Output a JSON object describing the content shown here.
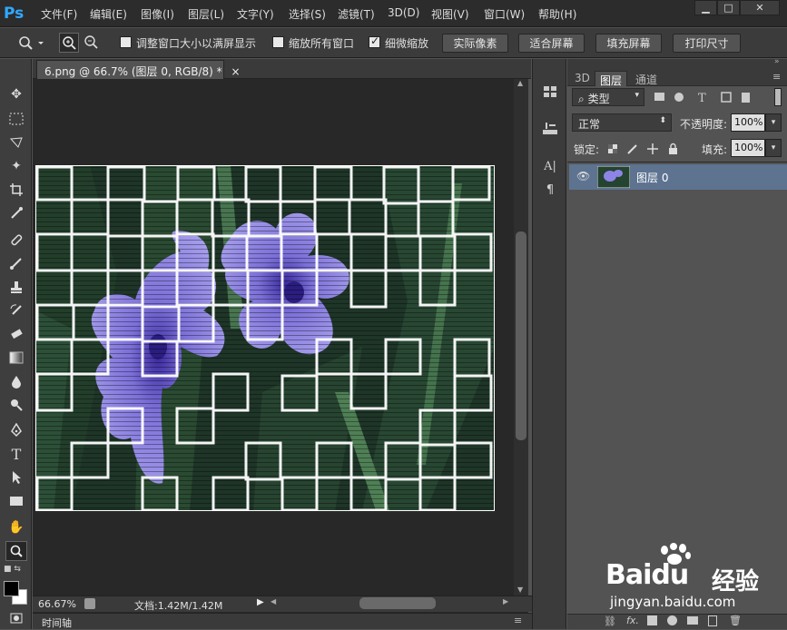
{
  "app": {
    "logo": "Ps",
    "brand_color": "#31a8ff"
  },
  "menu": [
    "文件(F)",
    "编辑(E)",
    "图像(I)",
    "图层(L)",
    "文字(Y)",
    "选择(S)",
    "滤镜(T)",
    "3D(D)",
    "视图(V)",
    "窗口(W)",
    "帮助(H)"
  ],
  "window_controls": {
    "minimize": "▁",
    "maximize": "□",
    "close": "✕"
  },
  "options": {
    "resize_windows": "调整窗口大小以满屏显示",
    "zoom_all": "缩放所有窗口",
    "scrubby_zoom": "细微缩放",
    "actual_pixels": "实际像素",
    "fit_screen": "适合屏幕",
    "fill_screen": "填充屏幕",
    "print_size": "打印尺寸",
    "resize_checked": false,
    "zoom_all_checked": false,
    "scrubby_checked": true
  },
  "document": {
    "tab_title": "6.png @ 66.7% (图层 0, RGB/8) *",
    "tab_close": "×",
    "zoom": "66.67%",
    "doc_info": "文档:1.42M/1.42M"
  },
  "timeline": {
    "label": "时间轴"
  },
  "layers_panel": {
    "tabs": [
      "3D",
      "图层",
      "通道"
    ],
    "active_tab": "图层",
    "filter_kind": "类型",
    "blend_mode": "正常",
    "opacity_label": "不透明度:",
    "opacity_value": "100%",
    "lock_label": "锁定:",
    "fill_label": "填充:",
    "fill_value": "100%",
    "layers": [
      {
        "name": "图层 0",
        "visible": true,
        "selected": true
      }
    ]
  },
  "watermark": {
    "brand": "Baidu",
    "cn": "经验",
    "url": "jingyan.baidu.com"
  },
  "colors": {
    "accent": "#31a8ff",
    "selection": "#5d7390",
    "panel": "#535353",
    "canvas_bg": "#282828"
  }
}
